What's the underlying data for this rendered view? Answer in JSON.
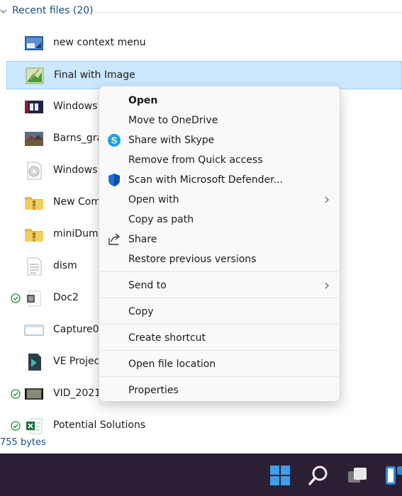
{
  "group": {
    "title": "Recent files (20)"
  },
  "files": [
    {
      "name": "new context menu",
      "icon": "image-thumbnail-icon",
      "synced": false
    },
    {
      "name": "Final with Image",
      "icon": "image-editor-file-icon",
      "synced": false,
      "selected": true
    },
    {
      "name": "Windows",
      "icon": "image-thumbnail-icon",
      "synced": false
    },
    {
      "name": "Barns_gra",
      "icon": "image-thumbnail-icon",
      "synced": false
    },
    {
      "name": "Windows",
      "icon": "disc-image-icon",
      "synced": false
    },
    {
      "name": "New Com",
      "icon": "zip-folder-icon",
      "synced": false
    },
    {
      "name": "miniDump",
      "icon": "zip-folder-icon",
      "synced": false
    },
    {
      "name": "dism",
      "icon": "text-document-icon",
      "synced": false
    },
    {
      "name": "Doc2",
      "icon": "word-document-icon",
      "synced": true
    },
    {
      "name": "Capture0",
      "icon": "screenshot-thumbnail-icon",
      "synced": false
    },
    {
      "name": "VE Projec",
      "icon": "video-project-icon",
      "synced": false
    },
    {
      "name": "VID_2021",
      "icon": "video-thumbnail-icon",
      "synced": true
    },
    {
      "name": "Potential Solutions",
      "icon": "excel-document-icon",
      "synced": true
    }
  ],
  "status_bar": {
    "text": "755 bytes"
  },
  "context_menu": {
    "items": [
      {
        "label": "Open",
        "bold": true
      },
      {
        "label": "Move to OneDrive"
      },
      {
        "label": "Share with Skype",
        "icon": "skype-icon"
      },
      {
        "label": "Remove from Quick access"
      },
      {
        "label": "Scan with Microsoft Defender...",
        "icon": "defender-shield-icon"
      },
      {
        "label": "Open with",
        "submenu": true
      },
      {
        "label": "Copy as path"
      },
      {
        "label": "Share",
        "icon": "share-icon"
      },
      {
        "label": "Restore previous versions"
      },
      {
        "label": "Send to",
        "submenu": true
      },
      {
        "label": "Copy"
      },
      {
        "label": "Create shortcut"
      },
      {
        "label": "Open file location"
      },
      {
        "label": "Properties"
      }
    ]
  },
  "taskbar": {
    "icons": [
      "start-icon",
      "search-icon",
      "task-view-icon",
      "widgets-icon"
    ]
  },
  "colors": {
    "selection_bg": "#cce8ff",
    "selection_border": "#99d1ff",
    "taskbar_bg": "#2b1f33",
    "link_blue": "#1a4f8a"
  }
}
